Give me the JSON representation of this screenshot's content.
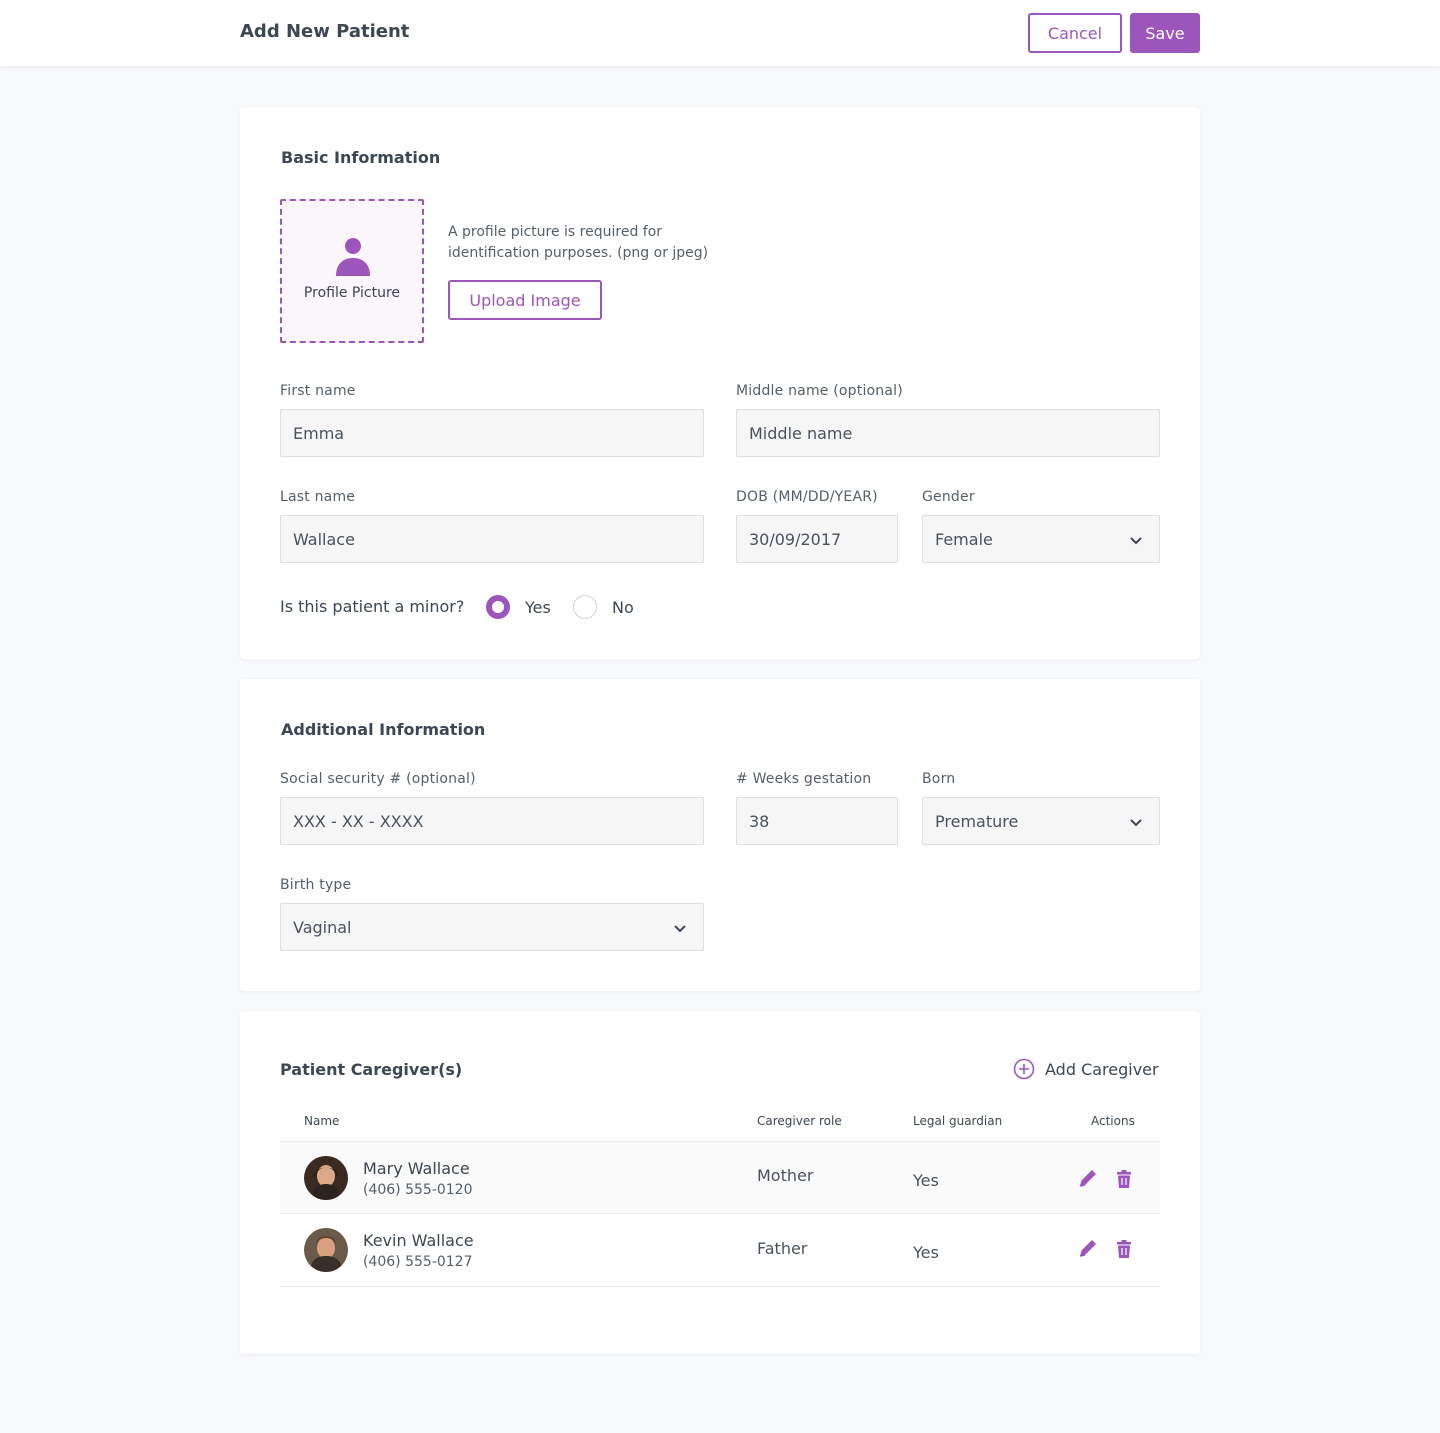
{
  "header": {
    "title": "Add New Patient",
    "cancel_label": "Cancel",
    "save_label": "Save"
  },
  "basic": {
    "title": "Basic Information",
    "profile_label": "Profile Picture",
    "profile_help": "A profile picture is required for identification purposes. (png or jpeg)",
    "upload_label": "Upload Image",
    "first_name_label": "First name",
    "first_name_value": "Emma",
    "middle_name_label": "Middle name (optional)",
    "middle_name_placeholder": "Middle name",
    "last_name_label": "Last name",
    "last_name_value": "Wallace",
    "dob_label": "DOB (MM/DD/YEAR)",
    "dob_value": "30/09/2017",
    "gender_label": "Gender",
    "gender_value": "Female",
    "minor_question": "Is this patient a minor?",
    "minor_yes": "Yes",
    "minor_no": "No",
    "minor_selected": "Yes"
  },
  "additional": {
    "title": "Additional Information",
    "ssn_label": "Social security # (optional)",
    "ssn_placeholder": "XXX - XX - XXXX",
    "weeks_label": "# Weeks gestation",
    "weeks_value": "38",
    "born_label": "Born",
    "born_value": "Premature",
    "birth_type_label": "Birth type",
    "birth_type_value": "Vaginal"
  },
  "caregivers": {
    "title": "Patient Caregiver(s)",
    "add_label": "Add Caregiver",
    "columns": [
      "Name",
      "Caregiver role",
      "Legal guardian",
      "Actions"
    ],
    "rows": [
      {
        "name": "Mary Wallace",
        "phone": "(406) 555-0120",
        "role": "Mother",
        "guardian": "Yes"
      },
      {
        "name": "Kevin Wallace",
        "phone": "(406) 555-0127",
        "role": "Father",
        "guardian": "Yes"
      }
    ]
  },
  "colors": {
    "accent": "#9c55bb",
    "background": "#f8f9fc",
    "field_bg": "#f6f6f7"
  },
  "icons": [
    "user-icon",
    "chevron-down-icon",
    "plus-circle-icon",
    "pencil-icon",
    "trash-icon"
  ]
}
